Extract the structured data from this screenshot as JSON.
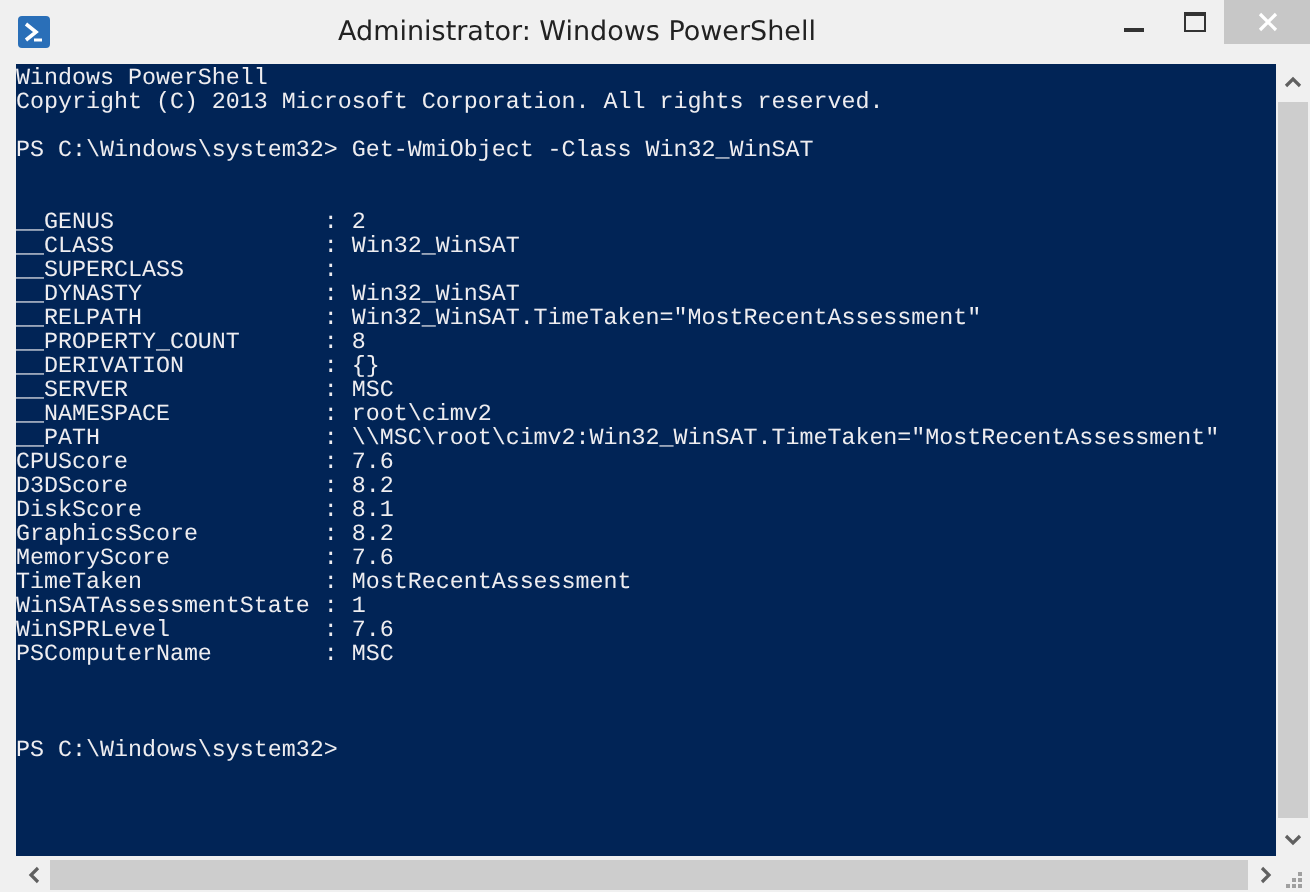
{
  "window": {
    "title": "Administrator: Windows PowerShell"
  },
  "console": {
    "banner": [
      "Windows PowerShell",
      "Copyright (C) 2013 Microsoft Corporation. All rights reserved."
    ],
    "command": {
      "prompt": "PS C:\\Windows\\system32>",
      "text": "Get-WmiObject -Class Win32_WinSAT"
    },
    "separator": ":",
    "properties": [
      {
        "name": "__GENUS",
        "value": "2"
      },
      {
        "name": "__CLASS",
        "value": "Win32_WinSAT"
      },
      {
        "name": "__SUPERCLASS"
      },
      {
        "name": "__DYNASTY",
        "value": "Win32_WinSAT"
      },
      {
        "name": "__RELPATH",
        "value": "Win32_WinSAT.TimeTaken=\"MostRecentAssessment\""
      },
      {
        "name": "__PROPERTY_COUNT",
        "value": "8"
      },
      {
        "name": "__DERIVATION",
        "value": "{}"
      },
      {
        "name": "__SERVER",
        "value": "MSC"
      },
      {
        "name": "__NAMESPACE",
        "value": "root\\cimv2"
      },
      {
        "name": "__PATH",
        "value": "\\\\MSC\\root\\cimv2:Win32_WinSAT.TimeTaken=\"MostRecentAssessment\""
      },
      {
        "name": "CPUScore",
        "value": "7.6"
      },
      {
        "name": "D3DScore",
        "value": "8.2"
      },
      {
        "name": "DiskScore",
        "value": "8.1"
      },
      {
        "name": "GraphicsScore",
        "value": "8.2"
      },
      {
        "name": "MemoryScore",
        "value": "7.6"
      },
      {
        "name": "TimeTaken",
        "value": "MostRecentAssessment"
      },
      {
        "name": "WinSATAssessmentState",
        "value": "1"
      },
      {
        "name": "WinSPRLevel",
        "value": "7.6"
      },
      {
        "name": "PSComputerName",
        "value": "MSC"
      }
    ],
    "final_prompt": "PS C:\\Windows\\system32>"
  }
}
